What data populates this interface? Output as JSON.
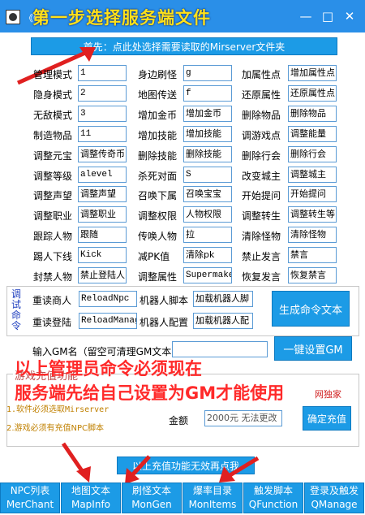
{
  "window": {
    "small_title": "《GM",
    "overlay_title": "第一步选择服务端文件",
    "minimize_icon": "minimize-icon",
    "maximize_icon": "maximize-icon",
    "close_icon": "close-icon"
  },
  "first_button": "首先：点此处选择需要读取的Mirserver文件夹",
  "commands": [
    {
      "label": "管理模式",
      "value": "1"
    },
    {
      "label": "身边刷怪",
      "value": "g"
    },
    {
      "label": "加属性点",
      "value": "增加属性点"
    },
    {
      "label": "隐身模式",
      "value": "2"
    },
    {
      "label": "地图传送",
      "value": "f"
    },
    {
      "label": "还原属性",
      "value": "还原属性点"
    },
    {
      "label": "无敌模式",
      "value": "3"
    },
    {
      "label": "增加金币",
      "value": "增加金币"
    },
    {
      "label": "删除物品",
      "value": "删除物品"
    },
    {
      "label": "制造物品",
      "value": "11"
    },
    {
      "label": "增加技能",
      "value": "增加技能"
    },
    {
      "label": "调游戏点",
      "value": "调整能量"
    },
    {
      "label": "调整元宝",
      "value": "调整传奇币"
    },
    {
      "label": "删除技能",
      "value": "删除技能"
    },
    {
      "label": "删除行会",
      "value": "删除行会"
    },
    {
      "label": "调整等级",
      "value": "alevel"
    },
    {
      "label": "杀死对面",
      "value": "S"
    },
    {
      "label": "改变城主",
      "value": "调整城主"
    },
    {
      "label": "调整声望",
      "value": "调整声望"
    },
    {
      "label": "召唤下属",
      "value": "召唤宝宝"
    },
    {
      "label": "开始提问",
      "value": "开始提问"
    },
    {
      "label": "调整职业",
      "value": "调整职业"
    },
    {
      "label": "调整权限",
      "value": "人物权限"
    },
    {
      "label": "调整转生",
      "value": "调整转生等"
    },
    {
      "label": "跟踪人物",
      "value": "跟随"
    },
    {
      "label": "传唤人物",
      "value": "拉"
    },
    {
      "label": "清除怪物",
      "value": "清除怪物"
    },
    {
      "label": "踢人下线",
      "value": "Kick"
    },
    {
      "label": "减PK值",
      "value": "清除pk"
    },
    {
      "label": "禁止发言",
      "value": "禁言"
    },
    {
      "label": "封禁人物",
      "value": "禁止登陆人"
    },
    {
      "label": "调整属性",
      "value": "Supermake"
    },
    {
      "label": "恢复发言",
      "value": "恢复禁言"
    }
  ],
  "debug_group": {
    "label": "调试命令",
    "reload_merchant_label": "重读商人",
    "reload_merchant_value": "ReloadNpc",
    "reload_login_label": "重读登陆",
    "reload_login_value": "ReloadManage",
    "robot_script_label": "机器人脚本",
    "robot_script_value": "加载机器人脚",
    "robot_config_label": "机器人配置",
    "robot_config_value": "加载机器人配",
    "generate_button": "生成命令文本"
  },
  "gm_input": {
    "label": "输入GM名（留空可清理GM文本）",
    "value": "",
    "button": "一键设置GM"
  },
  "red_notice": {
    "line1": "以上管理员命令必须现在",
    "line2": "服务端先给自己设置为GM才能使用"
  },
  "recharge": {
    "group_title": "游戏充值功能",
    "note1": "1.软件必须选取Mirserver",
    "note2": "2.游戏必须有充值NPC脚本",
    "exclusive_text": "网独家",
    "amount_label": "金额",
    "amount_value": "2000元 无法更改",
    "confirm_button": "确定充值",
    "invalid_button": "以上充值功能无效再点我"
  },
  "bottom_tabs": [
    {
      "line1": "NPC列表",
      "line2": "MerChant"
    },
    {
      "line1": "地图文本",
      "line2": "MapInfo"
    },
    {
      "line1": "刷怪文本",
      "line2": "MonGen"
    },
    {
      "line1": "爆率目录",
      "line2": "MonItems"
    },
    {
      "line1": "触发脚本",
      "line2": "QFunction"
    },
    {
      "line1": "登录及触发",
      "line2": "QManage"
    }
  ]
}
